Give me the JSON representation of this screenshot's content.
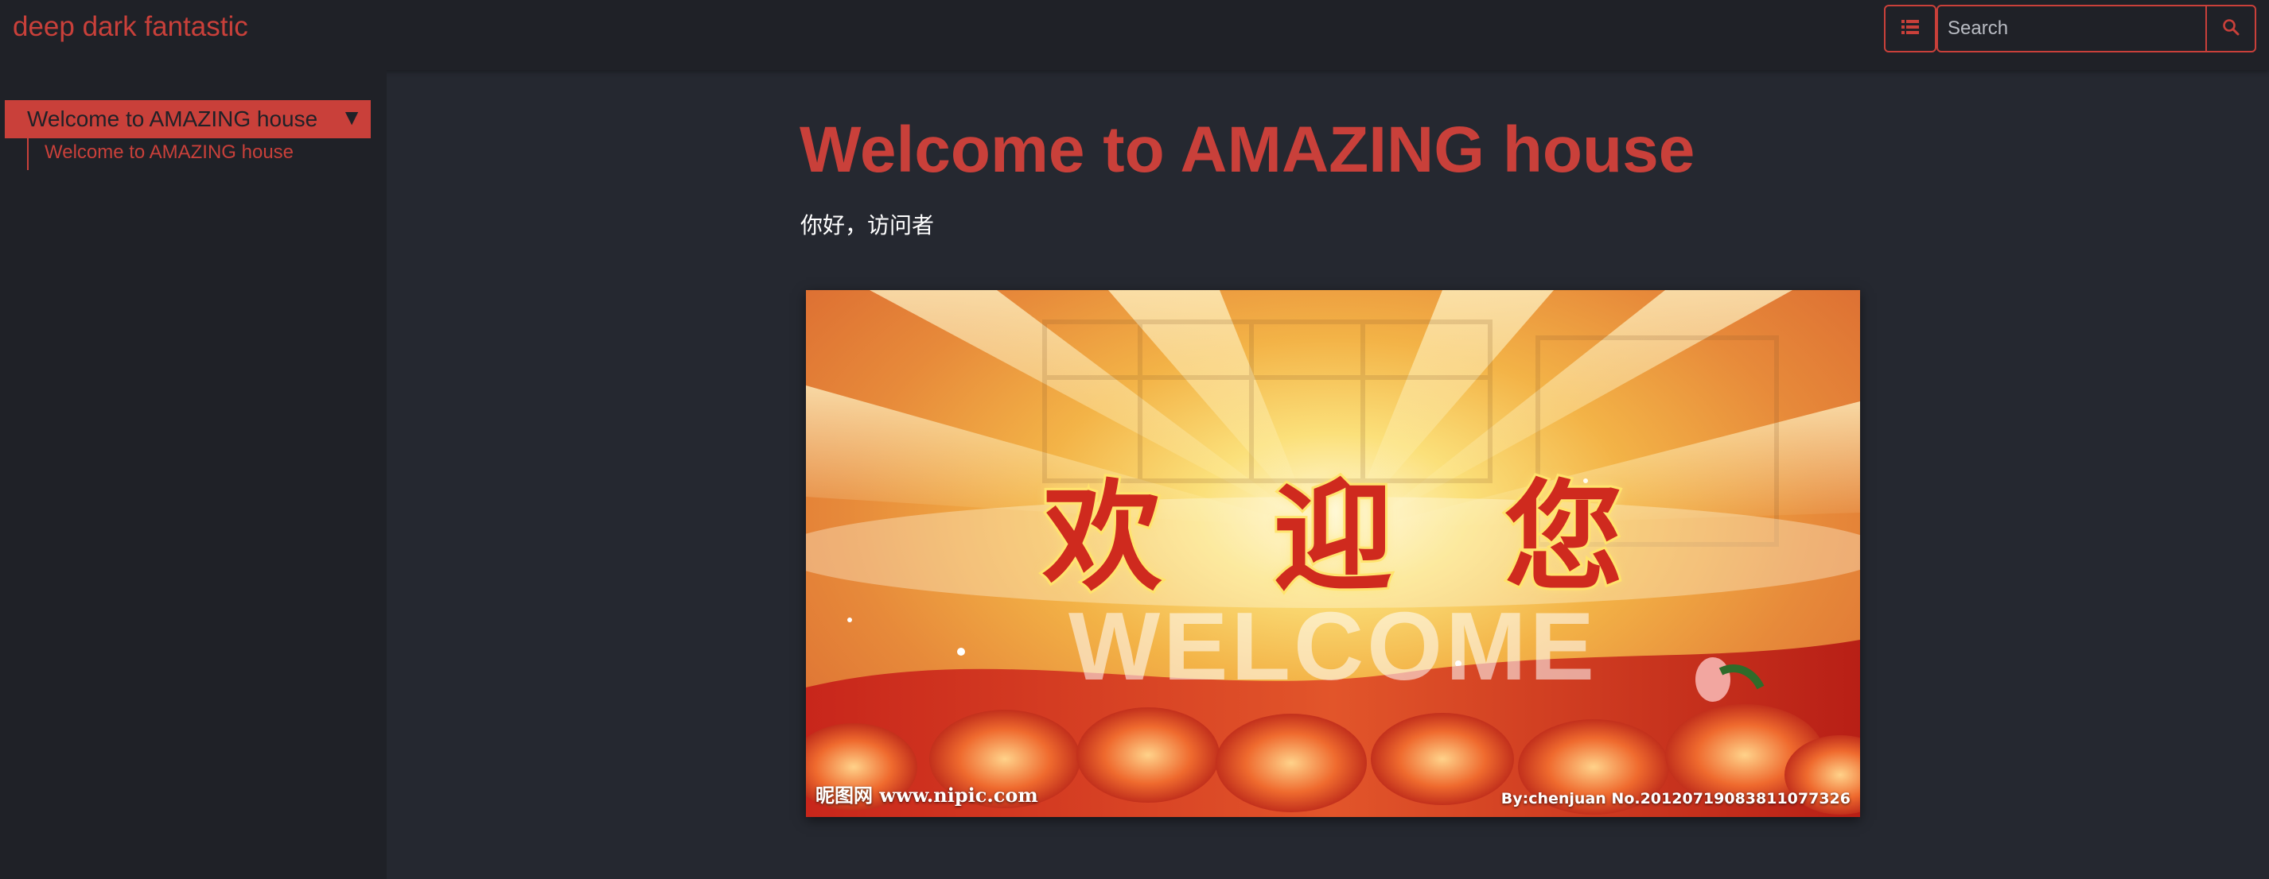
{
  "header": {
    "brand": "deep dark fantastic",
    "menu_icon": "list-icon",
    "search": {
      "placeholder": "Search",
      "value": "",
      "button_icon": "search-icon"
    }
  },
  "sidebar": {
    "items": [
      {
        "label": "Welcome to AMAZING house",
        "expanded": true,
        "caret_icon": "triangle-down-icon",
        "children": [
          {
            "label": "Welcome to AMAZING house"
          }
        ]
      }
    ]
  },
  "main": {
    "title": "Welcome to AMAZING house",
    "greeting": "你好，访问者",
    "banner": {
      "text_cn": "欢迎您",
      "text_en": "WELCOME",
      "caption_left": "昵图网 www.nipic.com",
      "caption_right": "By:chenjuan  No.20120719083811077326"
    }
  },
  "colors": {
    "accent": "#c9403a",
    "background": "#252830",
    "panel": "#1f2127",
    "text_light": "#ffffff"
  }
}
